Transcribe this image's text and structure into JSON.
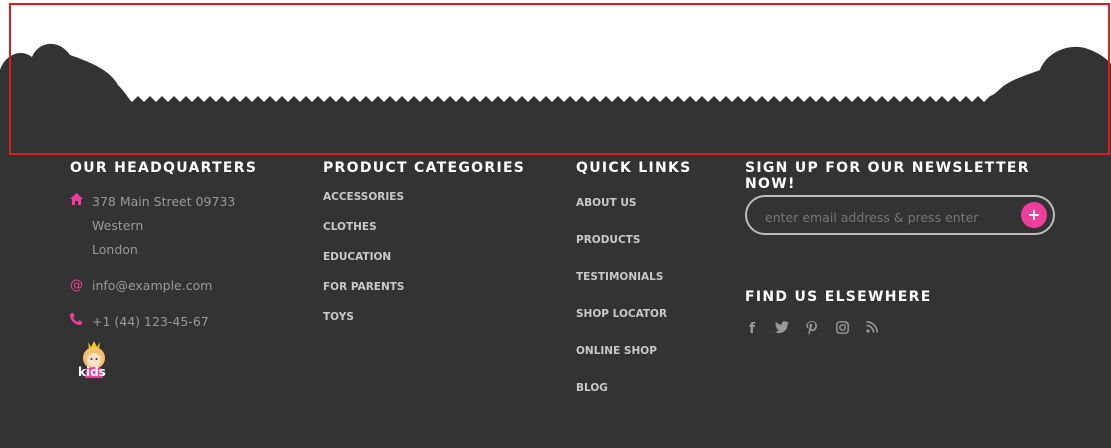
{
  "colors": {
    "footer_bg": "#333333",
    "accent": "#ef3d9b",
    "selection": "#e11b1b"
  },
  "headquarters": {
    "title": "OUR HEADQUARTERS",
    "address_icon": "home-icon",
    "address_line1": "378 Main Street 09733 Western",
    "address_line2": "London",
    "email_icon": "at-icon",
    "email": "info@example.com",
    "phone_icon": "phone-icon",
    "phone": "+1 (44) 123-45-67",
    "logo_text": "kids"
  },
  "categories": {
    "title": "PRODUCT CATEGORIES",
    "items": [
      "ACCESSORIES",
      "CLOTHES",
      "EDUCATION",
      "FOR PARENTS",
      "TOYS"
    ]
  },
  "quick_links": {
    "title": "QUICK LINKS",
    "items": [
      "ABOUT US",
      "PRODUCTS",
      "TESTIMONIALS",
      "SHOP LOCATOR",
      "ONLINE SHOP",
      "BLOG"
    ]
  },
  "newsletter": {
    "title": "SIGN UP FOR OUR NEWSLETTER NOW!",
    "placeholder": "enter email address & press enter",
    "button_icon": "plus-icon"
  },
  "elsewhere": {
    "title": "FIND US ELSEWHERE",
    "icons": [
      "facebook-icon",
      "twitter-icon",
      "pinterest-icon",
      "instagram-icon",
      "rss-icon"
    ]
  }
}
